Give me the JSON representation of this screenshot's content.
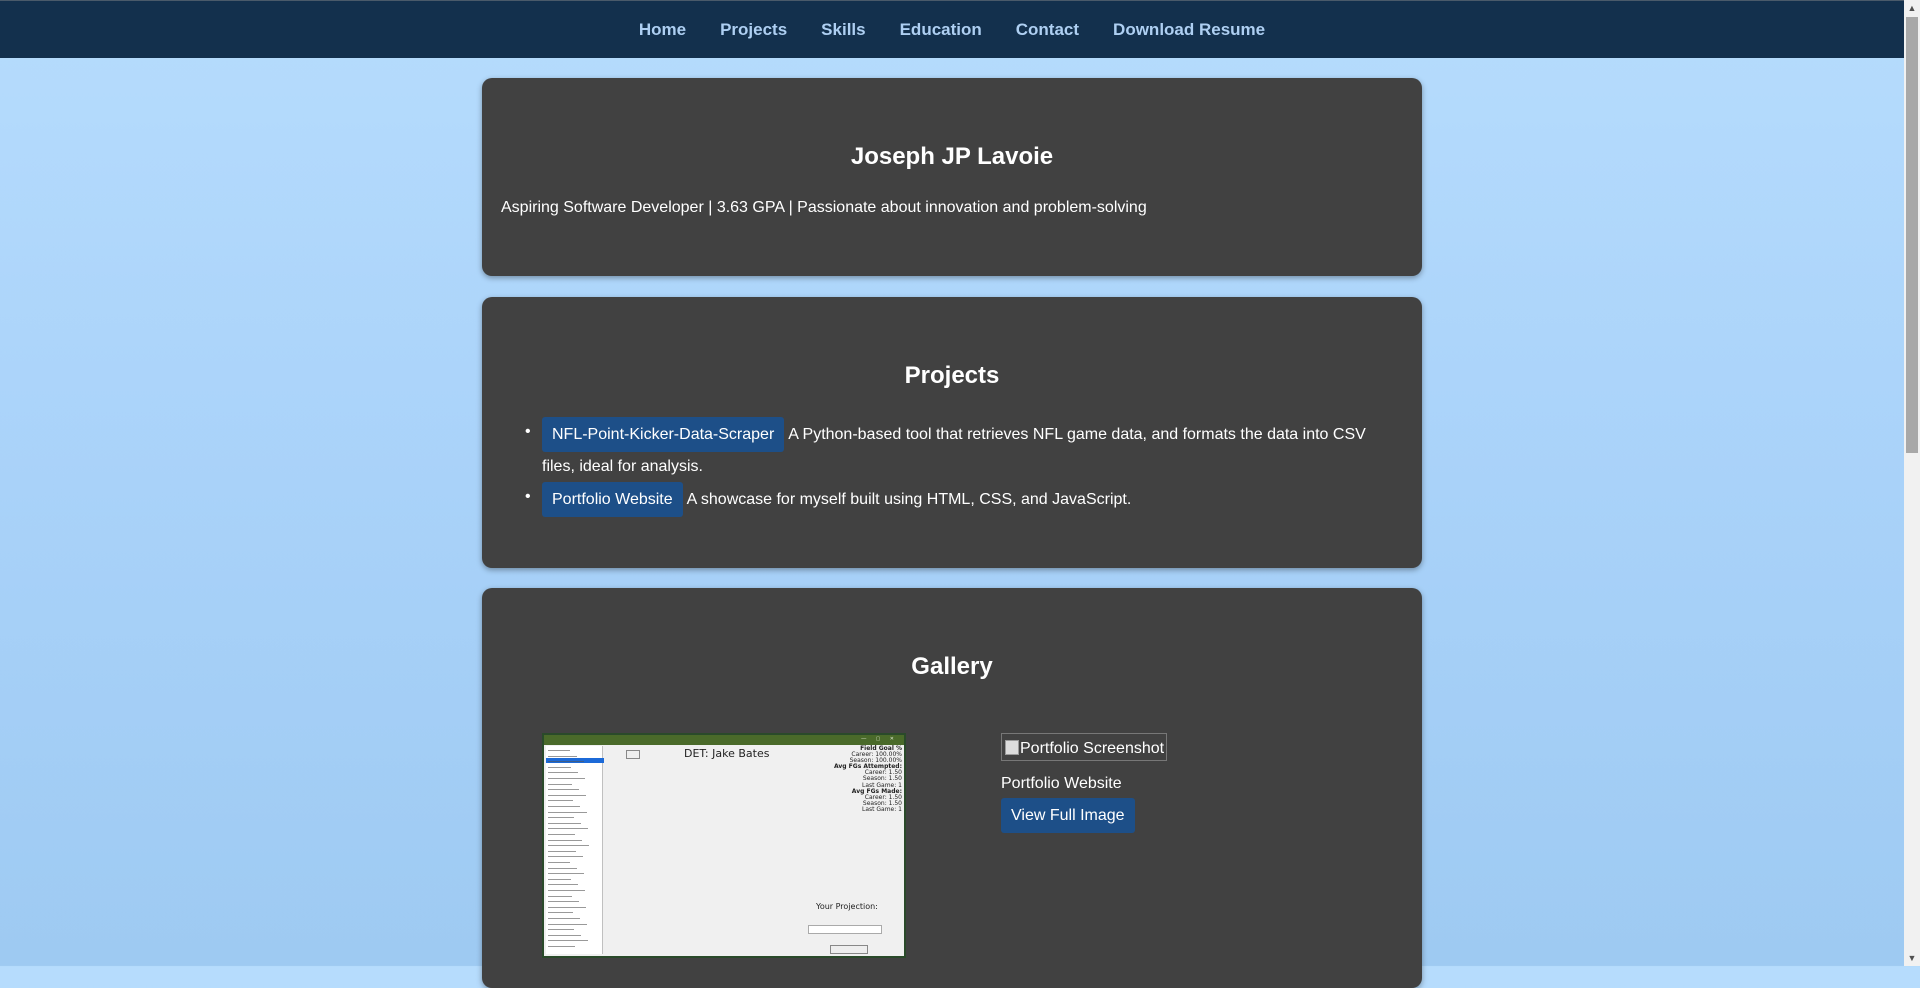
{
  "nav": {
    "items": [
      "Home",
      "Projects",
      "Skills",
      "Education",
      "Contact",
      "Download Resume"
    ]
  },
  "hero": {
    "name": "Joseph JP Lavoie",
    "tagline": "Aspiring Software Developer | 3.63 GPA | Passionate about innovation and problem-solving"
  },
  "projects": {
    "title": "Projects",
    "items": [
      {
        "link": "NFL-Point-Kicker-Data-Scraper",
        "line1": "A Python-based tool that retrieves NFL game data, and formats the data into CSV",
        "line2": "files, ideal for analysis."
      },
      {
        "link": "Portfolio Website",
        "line1": "A showcase for myself built using HTML, CSS, and JavaScript."
      }
    ]
  },
  "gallery": {
    "title": "Gallery",
    "screenshot": {
      "player": "DET: Jake Bates",
      "stats": [
        "Field Goal %",
        "Career: 100.00%",
        "Season: 100.00%",
        "Avg FGs Attempted:",
        "Career: 1.50",
        "Season: 1.50",
        "Last Game: 1",
        "Avg FGs Made:",
        "Career: 1.50",
        "Season: 1.50",
        "Last Game: 1"
      ],
      "projection_label": "Your Projection:"
    },
    "broken_alt": "Portfolio Screenshot",
    "caption": "Portfolio Website",
    "view_button": "View Full Image"
  }
}
